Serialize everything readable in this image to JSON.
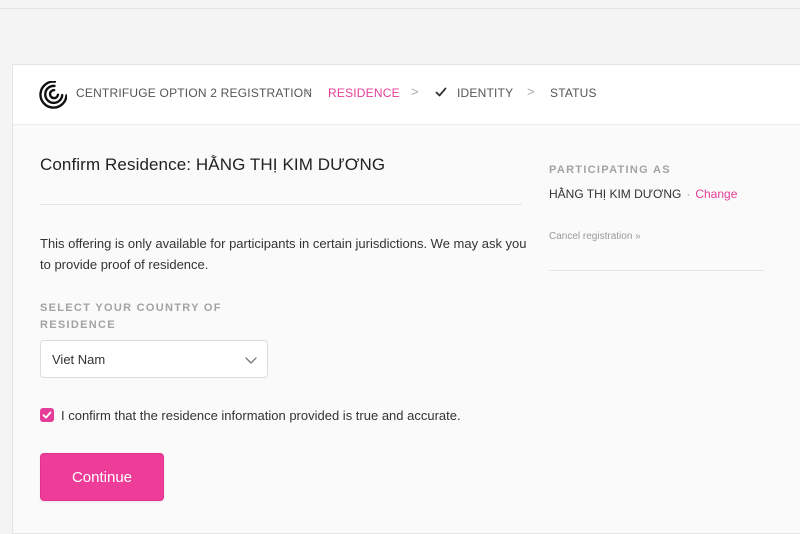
{
  "header": {
    "breadcrumbs": [
      {
        "label": "CENTRIFUGE OPTION 2 REGISTRATION"
      },
      {
        "label": "RESIDENCE"
      },
      {
        "label": "IDENTITY"
      },
      {
        "label": "STATUS"
      }
    ],
    "separator": ">"
  },
  "main": {
    "title": "Confirm Residence: HẰNG THỊ KIM DƯƠNG",
    "intro": "This offering is only available for participants in certain jurisdictions. We may ask you to provide proof of residence.",
    "country_label": "SELECT YOUR COUNTRY OF RESIDENCE",
    "country_value": "Viet Nam",
    "confirm_text": "I confirm that the residence information provided is true and accurate.",
    "confirm_checked": true,
    "continue_label": "Continue"
  },
  "sidebar": {
    "participating_label": "PARTICIPATING AS",
    "participant_name": "HẰNG THỊ KIM DƯƠNG",
    "dot": "·",
    "change_label": "Change",
    "cancel_label": "Cancel registration »"
  },
  "colors": {
    "accent": "#e63d98",
    "button": "#ee3d99"
  }
}
